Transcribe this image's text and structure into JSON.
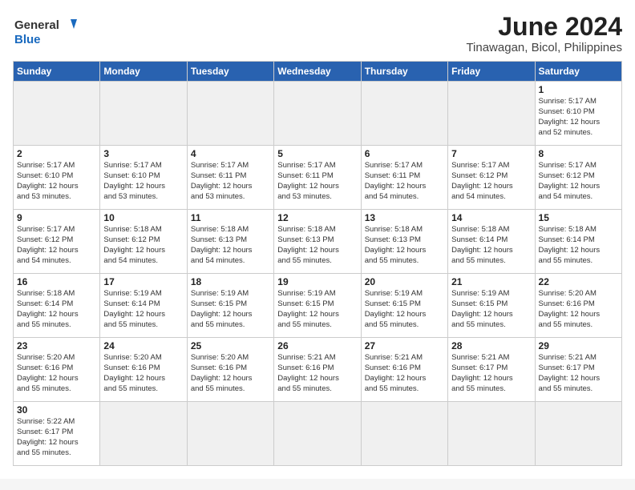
{
  "header": {
    "logo_general": "General",
    "logo_blue": "Blue",
    "title": "June 2024",
    "subtitle": "Tinawagan, Bicol, Philippines"
  },
  "weekdays": [
    "Sunday",
    "Monday",
    "Tuesday",
    "Wednesday",
    "Thursday",
    "Friday",
    "Saturday"
  ],
  "weeks": [
    [
      {
        "day": "",
        "info": "",
        "empty": true
      },
      {
        "day": "",
        "info": "",
        "empty": true
      },
      {
        "day": "",
        "info": "",
        "empty": true
      },
      {
        "day": "",
        "info": "",
        "empty": true
      },
      {
        "day": "",
        "info": "",
        "empty": true
      },
      {
        "day": "",
        "info": "",
        "empty": true
      },
      {
        "day": "1",
        "info": "Sunrise: 5:17 AM\nSunset: 6:10 PM\nDaylight: 12 hours\nand 52 minutes.",
        "empty": false
      }
    ],
    [
      {
        "day": "2",
        "info": "Sunrise: 5:17 AM\nSunset: 6:10 PM\nDaylight: 12 hours\nand 53 minutes.",
        "empty": false
      },
      {
        "day": "3",
        "info": "Sunrise: 5:17 AM\nSunset: 6:10 PM\nDaylight: 12 hours\nand 53 minutes.",
        "empty": false
      },
      {
        "day": "4",
        "info": "Sunrise: 5:17 AM\nSunset: 6:11 PM\nDaylight: 12 hours\nand 53 minutes.",
        "empty": false
      },
      {
        "day": "5",
        "info": "Sunrise: 5:17 AM\nSunset: 6:11 PM\nDaylight: 12 hours\nand 53 minutes.",
        "empty": false
      },
      {
        "day": "6",
        "info": "Sunrise: 5:17 AM\nSunset: 6:11 PM\nDaylight: 12 hours\nand 54 minutes.",
        "empty": false
      },
      {
        "day": "7",
        "info": "Sunrise: 5:17 AM\nSunset: 6:12 PM\nDaylight: 12 hours\nand 54 minutes.",
        "empty": false
      },
      {
        "day": "8",
        "info": "Sunrise: 5:17 AM\nSunset: 6:12 PM\nDaylight: 12 hours\nand 54 minutes.",
        "empty": false
      }
    ],
    [
      {
        "day": "9",
        "info": "Sunrise: 5:17 AM\nSunset: 6:12 PM\nDaylight: 12 hours\nand 54 minutes.",
        "empty": false
      },
      {
        "day": "10",
        "info": "Sunrise: 5:18 AM\nSunset: 6:12 PM\nDaylight: 12 hours\nand 54 minutes.",
        "empty": false
      },
      {
        "day": "11",
        "info": "Sunrise: 5:18 AM\nSunset: 6:13 PM\nDaylight: 12 hours\nand 54 minutes.",
        "empty": false
      },
      {
        "day": "12",
        "info": "Sunrise: 5:18 AM\nSunset: 6:13 PM\nDaylight: 12 hours\nand 55 minutes.",
        "empty": false
      },
      {
        "day": "13",
        "info": "Sunrise: 5:18 AM\nSunset: 6:13 PM\nDaylight: 12 hours\nand 55 minutes.",
        "empty": false
      },
      {
        "day": "14",
        "info": "Sunrise: 5:18 AM\nSunset: 6:14 PM\nDaylight: 12 hours\nand 55 minutes.",
        "empty": false
      },
      {
        "day": "15",
        "info": "Sunrise: 5:18 AM\nSunset: 6:14 PM\nDaylight: 12 hours\nand 55 minutes.",
        "empty": false
      }
    ],
    [
      {
        "day": "16",
        "info": "Sunrise: 5:18 AM\nSunset: 6:14 PM\nDaylight: 12 hours\nand 55 minutes.",
        "empty": false
      },
      {
        "day": "17",
        "info": "Sunrise: 5:19 AM\nSunset: 6:14 PM\nDaylight: 12 hours\nand 55 minutes.",
        "empty": false
      },
      {
        "day": "18",
        "info": "Sunrise: 5:19 AM\nSunset: 6:15 PM\nDaylight: 12 hours\nand 55 minutes.",
        "empty": false
      },
      {
        "day": "19",
        "info": "Sunrise: 5:19 AM\nSunset: 6:15 PM\nDaylight: 12 hours\nand 55 minutes.",
        "empty": false
      },
      {
        "day": "20",
        "info": "Sunrise: 5:19 AM\nSunset: 6:15 PM\nDaylight: 12 hours\nand 55 minutes.",
        "empty": false
      },
      {
        "day": "21",
        "info": "Sunrise: 5:19 AM\nSunset: 6:15 PM\nDaylight: 12 hours\nand 55 minutes.",
        "empty": false
      },
      {
        "day": "22",
        "info": "Sunrise: 5:20 AM\nSunset: 6:16 PM\nDaylight: 12 hours\nand 55 minutes.",
        "empty": false
      }
    ],
    [
      {
        "day": "23",
        "info": "Sunrise: 5:20 AM\nSunset: 6:16 PM\nDaylight: 12 hours\nand 55 minutes.",
        "empty": false
      },
      {
        "day": "24",
        "info": "Sunrise: 5:20 AM\nSunset: 6:16 PM\nDaylight: 12 hours\nand 55 minutes.",
        "empty": false
      },
      {
        "day": "25",
        "info": "Sunrise: 5:20 AM\nSunset: 6:16 PM\nDaylight: 12 hours\nand 55 minutes.",
        "empty": false
      },
      {
        "day": "26",
        "info": "Sunrise: 5:21 AM\nSunset: 6:16 PM\nDaylight: 12 hours\nand 55 minutes.",
        "empty": false
      },
      {
        "day": "27",
        "info": "Sunrise: 5:21 AM\nSunset: 6:16 PM\nDaylight: 12 hours\nand 55 minutes.",
        "empty": false
      },
      {
        "day": "28",
        "info": "Sunrise: 5:21 AM\nSunset: 6:17 PM\nDaylight: 12 hours\nand 55 minutes.",
        "empty": false
      },
      {
        "day": "29",
        "info": "Sunrise: 5:21 AM\nSunset: 6:17 PM\nDaylight: 12 hours\nand 55 minutes.",
        "empty": false
      }
    ],
    [
      {
        "day": "30",
        "info": "Sunrise: 5:22 AM\nSunset: 6:17 PM\nDaylight: 12 hours\nand 55 minutes.",
        "empty": false
      },
      {
        "day": "",
        "info": "",
        "empty": true
      },
      {
        "day": "",
        "info": "",
        "empty": true
      },
      {
        "day": "",
        "info": "",
        "empty": true
      },
      {
        "day": "",
        "info": "",
        "empty": true
      },
      {
        "day": "",
        "info": "",
        "empty": true
      },
      {
        "day": "",
        "info": "",
        "empty": true
      }
    ]
  ]
}
